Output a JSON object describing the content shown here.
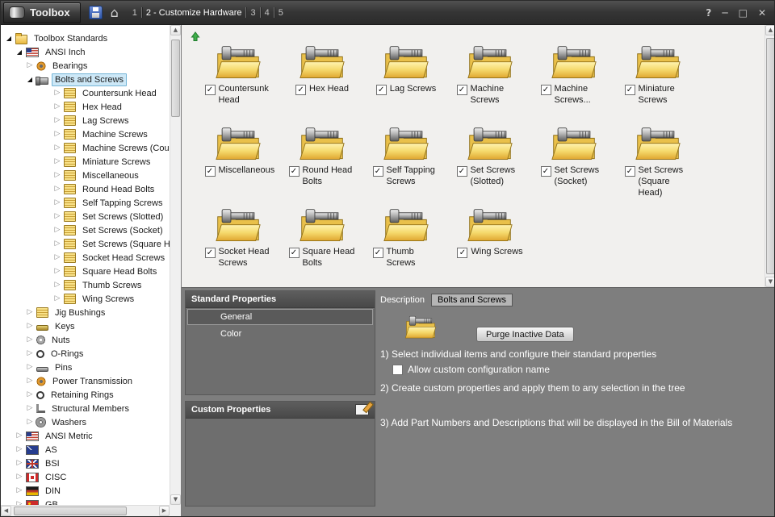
{
  "window": {
    "app_name": "Toolbox"
  },
  "icons": {
    "up_arrow": "▲",
    "down_arrow": "▼",
    "left_arrow": "◀",
    "right_arrow": "▶",
    "home": "⌂",
    "help": "?",
    "minimize": "─",
    "maximize": "□",
    "close": "✕",
    "check": "✓"
  },
  "titlebar": {
    "steps": [
      {
        "label": "1",
        "active": false
      },
      {
        "label": "2 - Customize Hardware",
        "active": true
      },
      {
        "label": "3",
        "active": false
      },
      {
        "label": "4",
        "active": false
      },
      {
        "label": "5",
        "active": false
      }
    ]
  },
  "tree": {
    "items": [
      {
        "label": "Toolbox Standards",
        "level": 0,
        "icon": "folder",
        "expanded": true,
        "selected": false
      },
      {
        "label": "ANSI Inch",
        "level": 1,
        "icon": "flag-us",
        "expanded": true,
        "selected": false
      },
      {
        "label": "Bearings",
        "level": 2,
        "icon": "gear",
        "expanded": false,
        "selected": false
      },
      {
        "label": "Bolts and Screws",
        "level": 2,
        "icon": "bolt",
        "expanded": true,
        "selected": true
      },
      {
        "label": "Countersunk Head",
        "level": 3,
        "icon": "category",
        "expanded": false,
        "selected": false
      },
      {
        "label": "Hex Head",
        "level": 3,
        "icon": "category",
        "expanded": false,
        "selected": false
      },
      {
        "label": "Lag Screws",
        "level": 3,
        "icon": "category",
        "expanded": false,
        "selected": false
      },
      {
        "label": "Machine Screws",
        "level": 3,
        "icon": "category",
        "expanded": false,
        "selected": false
      },
      {
        "label": "Machine Screws (Counter",
        "level": 3,
        "icon": "category",
        "expanded": false,
        "selected": false
      },
      {
        "label": "Miniature Screws",
        "level": 3,
        "icon": "category",
        "expanded": false,
        "selected": false
      },
      {
        "label": "Miscellaneous",
        "level": 3,
        "icon": "category",
        "expanded": false,
        "selected": false
      },
      {
        "label": "Round Head Bolts",
        "level": 3,
        "icon": "category",
        "expanded": false,
        "selected": false
      },
      {
        "label": "Self Tapping Screws",
        "level": 3,
        "icon": "category",
        "expanded": false,
        "selected": false
      },
      {
        "label": "Set Screws (Slotted)",
        "level": 3,
        "icon": "category",
        "expanded": false,
        "selected": false
      },
      {
        "label": "Set Screws (Socket)",
        "level": 3,
        "icon": "category",
        "expanded": false,
        "selected": false
      },
      {
        "label": "Set Screws (Square Head",
        "level": 3,
        "icon": "category",
        "expanded": false,
        "selected": false
      },
      {
        "label": "Socket Head Screws",
        "level": 3,
        "icon": "category",
        "expanded": false,
        "selected": false
      },
      {
        "label": "Square Head Bolts",
        "level": 3,
        "icon": "category",
        "expanded": false,
        "selected": false
      },
      {
        "label": "Thumb Screws",
        "level": 3,
        "icon": "category",
        "expanded": false,
        "selected": false
      },
      {
        "label": "Wing Screws",
        "level": 3,
        "icon": "category",
        "expanded": false,
        "selected": false
      },
      {
        "label": "Jig Bushings",
        "level": 2,
        "icon": "category",
        "expanded": false,
        "selected": false
      },
      {
        "label": "Keys",
        "level": 2,
        "icon": "key",
        "expanded": false,
        "selected": false
      },
      {
        "label": "Nuts",
        "level": 2,
        "icon": "hex",
        "expanded": false,
        "selected": false
      },
      {
        "label": "O-Rings",
        "level": 2,
        "icon": "ring",
        "expanded": false,
        "selected": false
      },
      {
        "label": "Pins",
        "level": 2,
        "icon": "pin",
        "expanded": false,
        "selected": false
      },
      {
        "label": "Power Transmission",
        "level": 2,
        "icon": "gear",
        "expanded": false,
        "selected": false
      },
      {
        "label": "Retaining Rings",
        "level": 2,
        "icon": "ring",
        "expanded": false,
        "selected": false
      },
      {
        "label": "Structural Members",
        "level": 2,
        "icon": "angle",
        "expanded": false,
        "selected": false
      },
      {
        "label": "Washers",
        "level": 2,
        "icon": "washer",
        "expanded": false,
        "selected": false
      },
      {
        "label": "ANSI Metric",
        "level": 1,
        "icon": "flag-us",
        "expanded": false,
        "selected": false
      },
      {
        "label": "AS",
        "level": 1,
        "icon": "flag-au",
        "expanded": false,
        "selected": false
      },
      {
        "label": "BSI",
        "level": 1,
        "icon": "flag-uk",
        "expanded": false,
        "selected": false
      },
      {
        "label": "CISC",
        "level": 1,
        "icon": "flag-ca",
        "expanded": false,
        "selected": false
      },
      {
        "label": "DIN",
        "level": 1,
        "icon": "flag-de",
        "expanded": false,
        "selected": false
      },
      {
        "label": "GB",
        "level": 1,
        "icon": "flag-cn",
        "expanded": false,
        "selected": false
      }
    ]
  },
  "content": {
    "folders": [
      {
        "label": "Countersunk Head",
        "checked": true
      },
      {
        "label": "Hex Head",
        "checked": true
      },
      {
        "label": "Lag Screws",
        "checked": true
      },
      {
        "label": "Machine Screws",
        "checked": true
      },
      {
        "label": "Machine Screws...",
        "checked": true
      },
      {
        "label": "Miniature Screws",
        "checked": true
      },
      {
        "label": "Miscellaneous",
        "checked": true
      },
      {
        "label": "Round Head Bolts",
        "checked": true
      },
      {
        "label": "Self Tapping Screws",
        "checked": true
      },
      {
        "label": "Set Screws (Slotted)",
        "checked": true
      },
      {
        "label": "Set Screws (Socket)",
        "checked": true
      },
      {
        "label": "Set Screws (Square Head)",
        "checked": true
      },
      {
        "label": "Socket Head Screws",
        "checked": true
      },
      {
        "label": "Square Head Bolts",
        "checked": true
      },
      {
        "label": "Thumb Screws",
        "checked": true
      },
      {
        "label": "Wing Screws",
        "checked": true
      }
    ]
  },
  "properties": {
    "standard_title": "Standard Properties",
    "items": [
      {
        "label": "General",
        "selected": true
      },
      {
        "label": "Color",
        "selected": false
      }
    ],
    "custom_title": "Custom Properties"
  },
  "detail": {
    "description_label": "Description",
    "description_value": "Bolts and Screws",
    "purge_button": "Purge Inactive Data",
    "step1": "1) Select individual items and configure their standard properties",
    "checkbox_label": "Allow custom configuration name",
    "checkbox_checked": false,
    "step2": "2) Create custom properties and apply them to any selection in the tree",
    "step3": "3) Add Part Numbers and Descriptions that will be displayed in the Bill of Materials"
  },
  "colors": {
    "selection_bg": "#cde8f7",
    "selection_border": "#74b4d6",
    "folder_yellow": "#edc54f",
    "panel_gray": "#7e7e7e",
    "titlebar_gray": "#3a3a3a"
  }
}
